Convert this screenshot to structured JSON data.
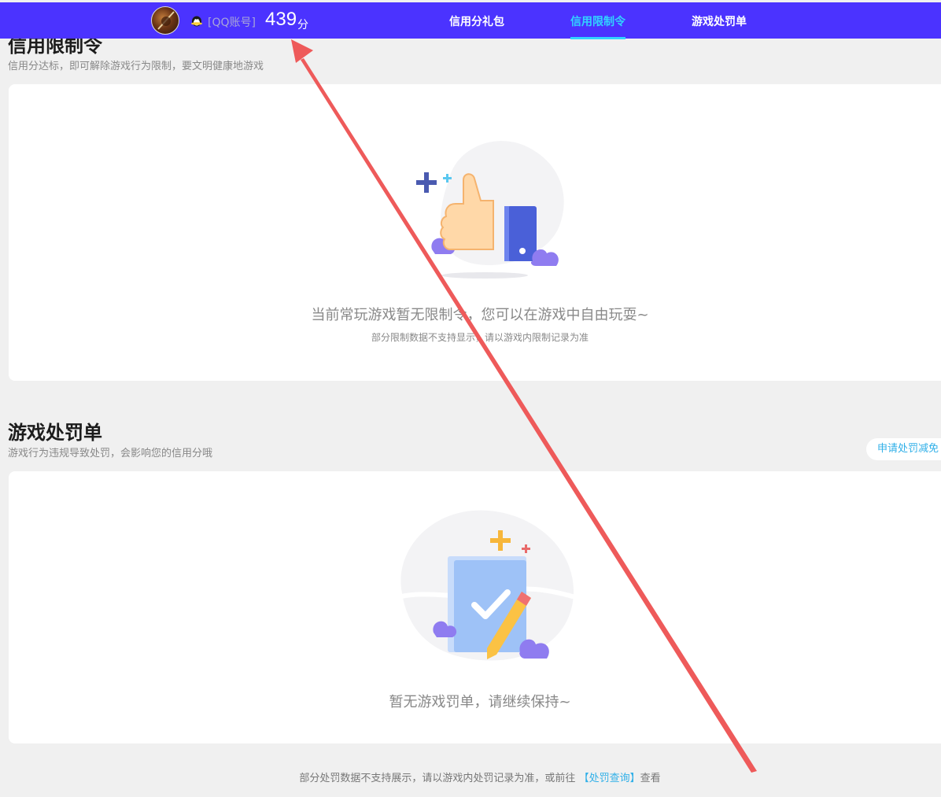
{
  "header": {
    "account_label": "[QQ账号]",
    "score": "439",
    "score_unit": "分",
    "tabs": [
      {
        "label": "信用分礼包",
        "active": false
      },
      {
        "label": "信用限制令",
        "active": true
      },
      {
        "label": "游戏处罚单",
        "active": false
      }
    ],
    "accent_color": "#31d4ff",
    "bar_color": "#4b33ff"
  },
  "restriction": {
    "title": "信用限制令",
    "subtitle": "信用分达标，即可解除游戏行为限制，要文明健康地游戏",
    "empty_main": "当前常玩游戏暂无限制令，您可以在游戏中自由玩耍~",
    "empty_sub": "部分限制数据不支持显示，请以游戏内限制记录为准",
    "illustration_icon": "thumbs-up-icon"
  },
  "penalty": {
    "title": "游戏处罚单",
    "subtitle": "游戏行为违规导致处罚，会影响您的信用分哦",
    "appeal_button": "申请处罚减免",
    "empty_main": "暂无游戏罚单，请继续保持~",
    "illustration_icon": "checklist-pencil-icon"
  },
  "footer": {
    "text_before": "部分处罚数据不支持展示，请以游戏内处罚记录为准，或前往",
    "link": "【处罚查询】",
    "text_after": "查看"
  }
}
